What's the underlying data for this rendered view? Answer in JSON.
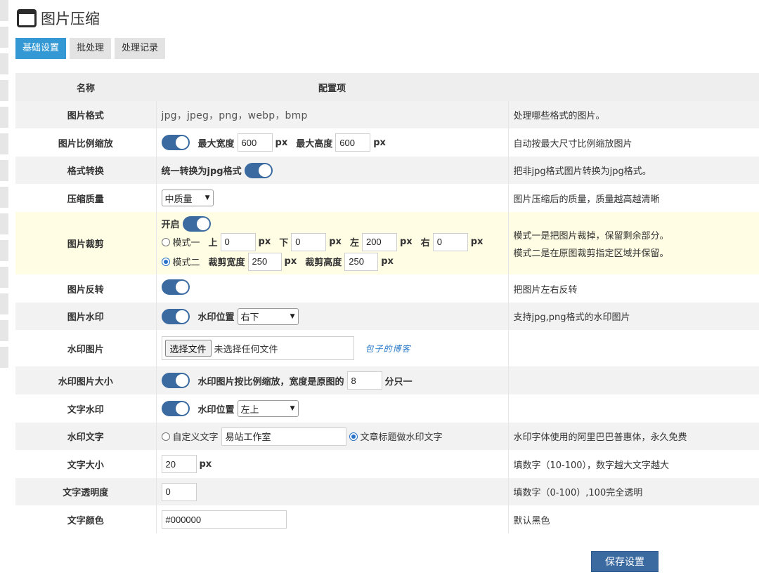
{
  "title": "图片压缩",
  "tabs": [
    {
      "label": "基础设置",
      "active": true
    },
    {
      "label": "批处理",
      "active": false
    },
    {
      "label": "处理记录",
      "active": false
    }
  ],
  "table": {
    "headers": {
      "name": "名称",
      "config": "配置项"
    },
    "rows": {
      "format": {
        "name": "图片格式",
        "value": "jpg，jpeg，png，webp，bmp",
        "desc": "处理哪些格式的图片。"
      },
      "scale": {
        "name": "图片比例缩放",
        "max_width_label": "最大宽度",
        "max_width": "600",
        "unit": "px",
        "max_height_label": "最大高度",
        "max_height": "600",
        "desc": "自动按最大尺寸比例缩放图片",
        "enabled": true
      },
      "convert": {
        "name": "格式转换",
        "label": "统一转换为jpg格式",
        "desc": "把非jpg格式图片转换为jpg格式。",
        "enabled": true
      },
      "quality": {
        "name": "压缩质量",
        "selected": "中质量",
        "desc": "图片压缩后的质量，质量越高越清晰"
      },
      "crop": {
        "name": "图片裁剪",
        "enable_label": "开启",
        "enabled": true,
        "mode1_label": "模式一",
        "top_label": "上",
        "top": "0",
        "bottom_label": "下",
        "bottom": "0",
        "left_label": "左",
        "left": "200",
        "right_label": "右",
        "right": "0",
        "unit": "px",
        "mode2_label": "模式二",
        "crop_width_label": "裁剪宽度",
        "crop_width": "250",
        "crop_height_label": "裁剪高度",
        "crop_height": "250",
        "selected_mode": "模式二",
        "desc1": "模式一是把图片裁掉，保留剩余部分。",
        "desc2": "模式二是在原图裁剪指定区域并保留。"
      },
      "flip": {
        "name": "图片反转",
        "desc": "把图片左右反转",
        "enabled": true
      },
      "watermark": {
        "name": "图片水印",
        "position_label": "水印位置",
        "position": "右下",
        "desc": "支持jpg,png格式的水印图片",
        "enabled": true
      },
      "watermark_image": {
        "name": "水印图片",
        "button": "选择文件",
        "status": "未选择任何文件",
        "signature": "包子的博客"
      },
      "watermark_size": {
        "name": "水印图片大小",
        "prefix": "水印图片按比例缩放，宽度是原图的",
        "value": "8",
        "suffix": "分只一",
        "enabled": true
      },
      "text_watermark": {
        "name": "文字水印",
        "position_label": "水印位置",
        "position": "左上",
        "enabled": true
      },
      "watermark_text": {
        "name": "水印文字",
        "custom_label": "自定义文字",
        "custom_value": "易站工作室",
        "title_label": "文章标题做水印文字",
        "selected": "文章标题做水印文字",
        "desc": "水印字体使用的阿里巴巴普惠体，永久免费"
      },
      "font_size": {
        "name": "文字大小",
        "value": "20",
        "unit": "px",
        "desc": "填数字（10-100），数字越大文字越大"
      },
      "opacity": {
        "name": "文字透明度",
        "value": "0",
        "desc": "填数字（0-100）,100完全透明"
      },
      "color": {
        "name": "文字颜色",
        "value": "#000000",
        "desc": "默认黑色"
      }
    }
  },
  "save_button": "保存设置",
  "colors": {
    "accent": "#3398d3",
    "toggle": "#3b6aa0",
    "highlight_row": "#fffde3"
  }
}
